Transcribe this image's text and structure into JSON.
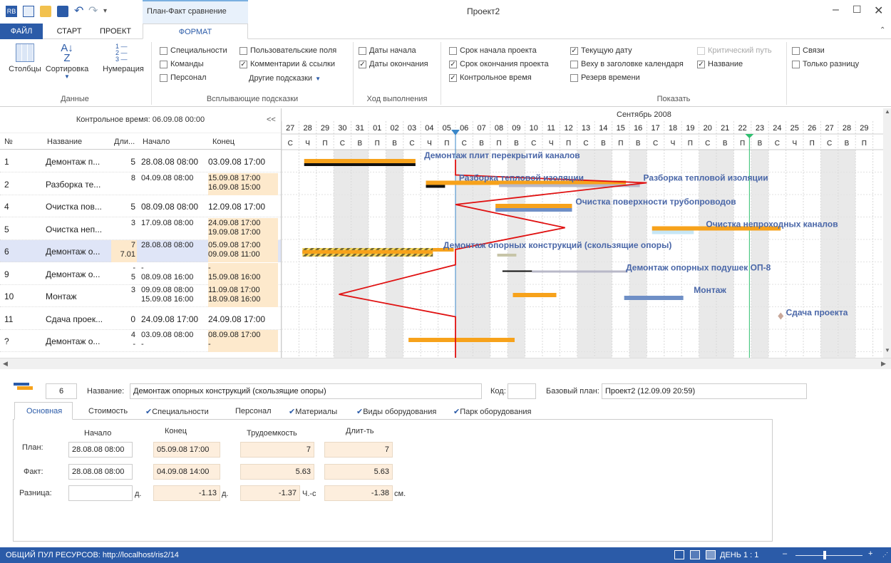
{
  "window": {
    "contextual_tab_group": "План-Факт сравнение",
    "title": "Проект2"
  },
  "ribbon_tabs": [
    "ФАЙЛ",
    "СТАРТ",
    "ПРОЕКТ",
    "ФОРМАТ"
  ],
  "ribbon": {
    "data_group": {
      "label": "Данные",
      "buttons": [
        "Столбцы",
        "Сортировка",
        "Нумерация"
      ]
    },
    "tooltips_group": {
      "label": "Всплывающие подсказки",
      "items": [
        {
          "label": "Специальности",
          "checked": false
        },
        {
          "label": "Команды",
          "checked": false
        },
        {
          "label": "Персонал",
          "checked": false
        },
        {
          "label": "Пользовательские поля",
          "checked": false
        },
        {
          "label": "Комментарии & ссылки",
          "checked": true
        }
      ],
      "more": "Другие подсказки"
    },
    "progress_group": {
      "label": "Ход выполнения",
      "items": [
        {
          "label": "Даты начала",
          "checked": false
        },
        {
          "label": "Даты окончания",
          "checked": true
        }
      ]
    },
    "show_group": {
      "label": "Показать",
      "items": [
        {
          "label": "Срок начала проекта",
          "checked": false
        },
        {
          "label": "Срок окончания проекта",
          "checked": true
        },
        {
          "label": "Контрольное время",
          "checked": true
        },
        {
          "label": "Текущую дату",
          "checked": true
        },
        {
          "label": "Веху в заголовке календаря",
          "checked": false
        },
        {
          "label": "Резерв времени",
          "checked": false
        },
        {
          "label": "Критический путь",
          "checked": false,
          "disabled": true
        },
        {
          "label": "Название",
          "checked": true
        },
        {
          "label": "Связи",
          "checked": false
        },
        {
          "label": "Только разницу",
          "checked": false
        }
      ]
    }
  },
  "table": {
    "control_time": "Контрольное время: 06.09.08 00:00",
    "collapse": "<<",
    "headers": [
      "№",
      "Название",
      "Дли...",
      "Начало",
      "Конец"
    ],
    "rows": [
      {
        "num": "1",
        "name": "Демонтаж п...",
        "dur": "5",
        "start": "28.08.08 08:00",
        "end": "03.09.08 17:00"
      },
      {
        "num": "2",
        "name": "Разборка те...",
        "dur": "8",
        "start": "04.09.08 08:00",
        "end": "15.09.08 17:00",
        "end2": "16.09.08 15:00"
      },
      {
        "num": "4",
        "name": "Очистка пов...",
        "dur": "5",
        "start": "08.09.08 08:00",
        "end": "12.09.08 17:00"
      },
      {
        "num": "5",
        "name": "Очистка неп...",
        "dur": "3",
        "start": "17.09.08 08:00",
        "end": "24.09.08 17:00",
        "end2": "19.09.08 17:00"
      },
      {
        "num": "6",
        "name": "Демонтаж о...",
        "dur": "7",
        "dur2": "7.01",
        "start": "28.08.08 08:00",
        "end": "05.09.08 17:00",
        "end2": "09.09.08 11:00"
      },
      {
        "num": "9",
        "name": "Демонтаж о...",
        "dur": "-",
        "dur2": "5",
        "start": "-",
        "start2": "08.09.08 16:00",
        "end": "-",
        "end2": "15.09.08 16:00"
      },
      {
        "num": "10",
        "name": "Монтаж",
        "dur": "3",
        "start": "09.09.08 08:00",
        "start2": "15.09.08 16:00",
        "end": "11.09.08 17:00",
        "end2": "18.09.08 16:00"
      },
      {
        "num": "11",
        "name": "Сдача проек...",
        "dur": "0",
        "start": "24.09.08 17:00",
        "end": "24.09.08 17:00"
      },
      {
        "num": "?",
        "name": "Демонтаж о...",
        "dur": "4",
        "dur2": "-",
        "start": "03.09.08 08:00",
        "start2": "-",
        "end": "08.09.08 17:00",
        "end2": "-"
      }
    ]
  },
  "gantt": {
    "month": "Сентябрь 2008",
    "days": [
      "27",
      "28",
      "29",
      "30",
      "31",
      "01",
      "02",
      "03",
      "04",
      "05",
      "06",
      "07",
      "08",
      "09",
      "10",
      "11",
      "12",
      "13",
      "14",
      "15",
      "16",
      "17",
      "18",
      "19",
      "20",
      "21",
      "22",
      "23",
      "24",
      "25",
      "26",
      "27",
      "28",
      "29"
    ],
    "weekdays": [
      "С",
      "Ч",
      "П",
      "С",
      "В",
      "П",
      "В",
      "С",
      "Ч",
      "П",
      "С",
      "В",
      "П",
      "В",
      "С",
      "Ч",
      "П",
      "С",
      "В",
      "П",
      "В",
      "С",
      "Ч",
      "П",
      "С",
      "В",
      "П",
      "В",
      "С",
      "Ч",
      "П",
      "С",
      "В",
      "П"
    ],
    "task_labels": [
      "Демонтаж  плит перекрытий каналов",
      "Разборка тепловой изоляции",
      "Разборка тепловой изоляции",
      "Очистка поверхности трубопроводов",
      "Очистка непроходных каналов",
      "Демонтаж опорных конструкций (скользящие опоры)",
      "Демонтаж опорных подушек ОП-8",
      "Монтаж",
      "Сдача проекта"
    ],
    "colors": {
      "plan": "#f7a21b",
      "fact": "#6f8fc6",
      "baseline": "#111111",
      "control_line": "#e01010",
      "today_line": "#2fbf6f"
    }
  },
  "detail": {
    "id": "6",
    "name_label": "Название:",
    "name_value": "Демонтаж опорных конструкций (скользящие опоры)",
    "code_label": "Код:",
    "code_value": "",
    "baseline_label": "Базовый план:",
    "baseline_value": "Проект2 (12.09.09 20:59)",
    "tabs": [
      "Основная",
      "Стоимость",
      "Специальности",
      "Персонал",
      "Материалы",
      "Виды оборудования",
      "Парк оборудования"
    ],
    "col_headers": [
      "Начало",
      "Конец",
      "Трудоемкость",
      "Длит-ть"
    ],
    "plan_label": "План:",
    "fact_label": "Факт:",
    "diff_label": "Разница:",
    "plan": {
      "start": "28.08.08 08:00",
      "end": "05.09.08 17:00",
      "labor": "7",
      "duration": "7"
    },
    "fact": {
      "start": "28.08.08 08:00",
      "end": "04.09.08 14:00",
      "labor": "5.63",
      "duration": "5.63"
    },
    "diff": {
      "start": "",
      "start_unit": "д.",
      "end": "-1.13",
      "end_unit": "д.",
      "labor": "-1.37",
      "labor_unit": "Ч.-с",
      "duration": "-1.38",
      "duration_unit": "см."
    }
  },
  "status": {
    "pool": "ОБЩИЙ ПУЛ РЕСУРСОВ: http://localhost/ris2/14",
    "zoom": "ДЕНЬ 1 : 1"
  }
}
